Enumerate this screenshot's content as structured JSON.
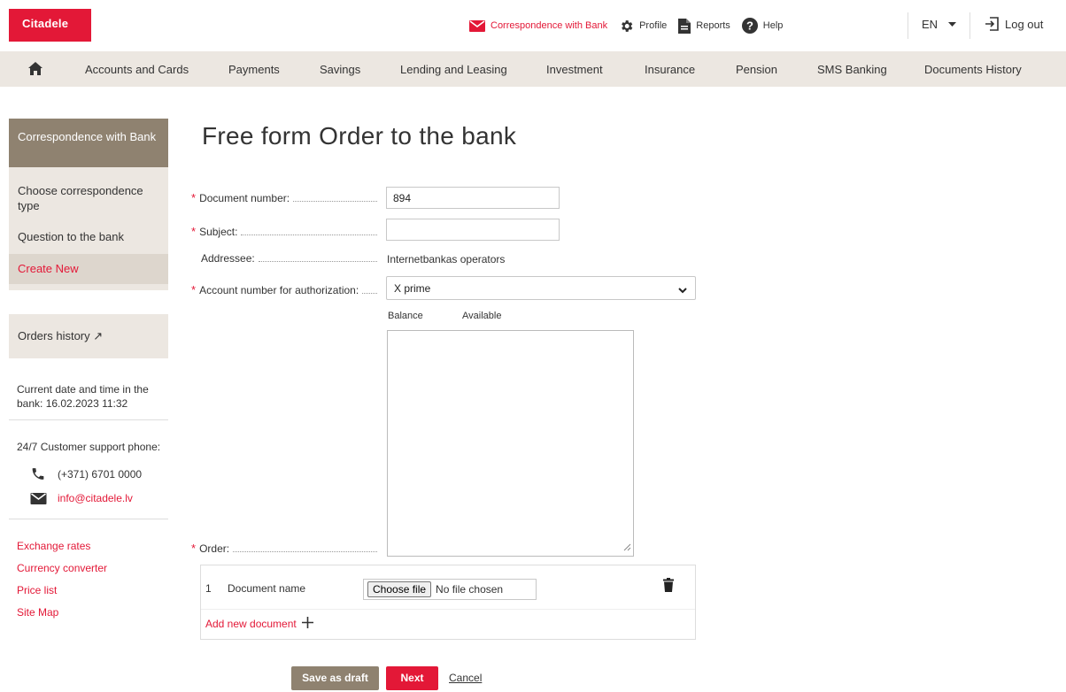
{
  "header": {
    "logo": "Citadele",
    "links": {
      "correspondence": "Correspondence with Bank",
      "profile": "Profile",
      "reports": "Reports",
      "help": "Help"
    },
    "language": "EN",
    "logout": "Log out"
  },
  "nav": {
    "items": [
      "Accounts and Cards",
      "Payments",
      "Savings",
      "Lending and Leasing",
      "Investment",
      "Insurance",
      "Pension",
      "SMS Banking",
      "Documents History"
    ]
  },
  "sidebar": {
    "heading": "Correspondence with Bank",
    "items": [
      {
        "label": "Choose correspondence type"
      },
      {
        "label": "Question to the bank"
      },
      {
        "label": "Create New"
      }
    ],
    "orders_history": "Orders history ↗",
    "bank_time": "Current date and time in the bank: 16.02.2023 11:32",
    "support_label": "24/7 Customer support phone:",
    "phone": "(+371) 6701 0000",
    "email": "info@citadele.lv",
    "links": [
      "Exchange rates",
      "Currency converter",
      "Price list",
      "Site Map"
    ]
  },
  "form": {
    "title": "Free form Order to the bank",
    "required_mark": "*",
    "document_number_label": "Document number:",
    "document_number_value": "894",
    "subject_label": "Subject:",
    "subject_value": "",
    "addressee_label": "Addressee:",
    "addressee_value": "Internetbankas operators",
    "account_label": "Account number for authorization:",
    "account_value": "X prime",
    "balance_label": "Balance",
    "available_label": "Available",
    "order_label": "Order:",
    "documents": [
      {
        "number": "1",
        "name": "Document name",
        "choose_label": "Choose file",
        "file_status": "No file chosen"
      }
    ],
    "add_document": "Add new document"
  },
  "actions": {
    "save_draft": "Save as draft",
    "next": "Next",
    "cancel": "Cancel"
  },
  "colors": {
    "brand_red": "#e31837",
    "sidebar_brown": "#8f8270",
    "nav_beige": "#ece7e1"
  }
}
